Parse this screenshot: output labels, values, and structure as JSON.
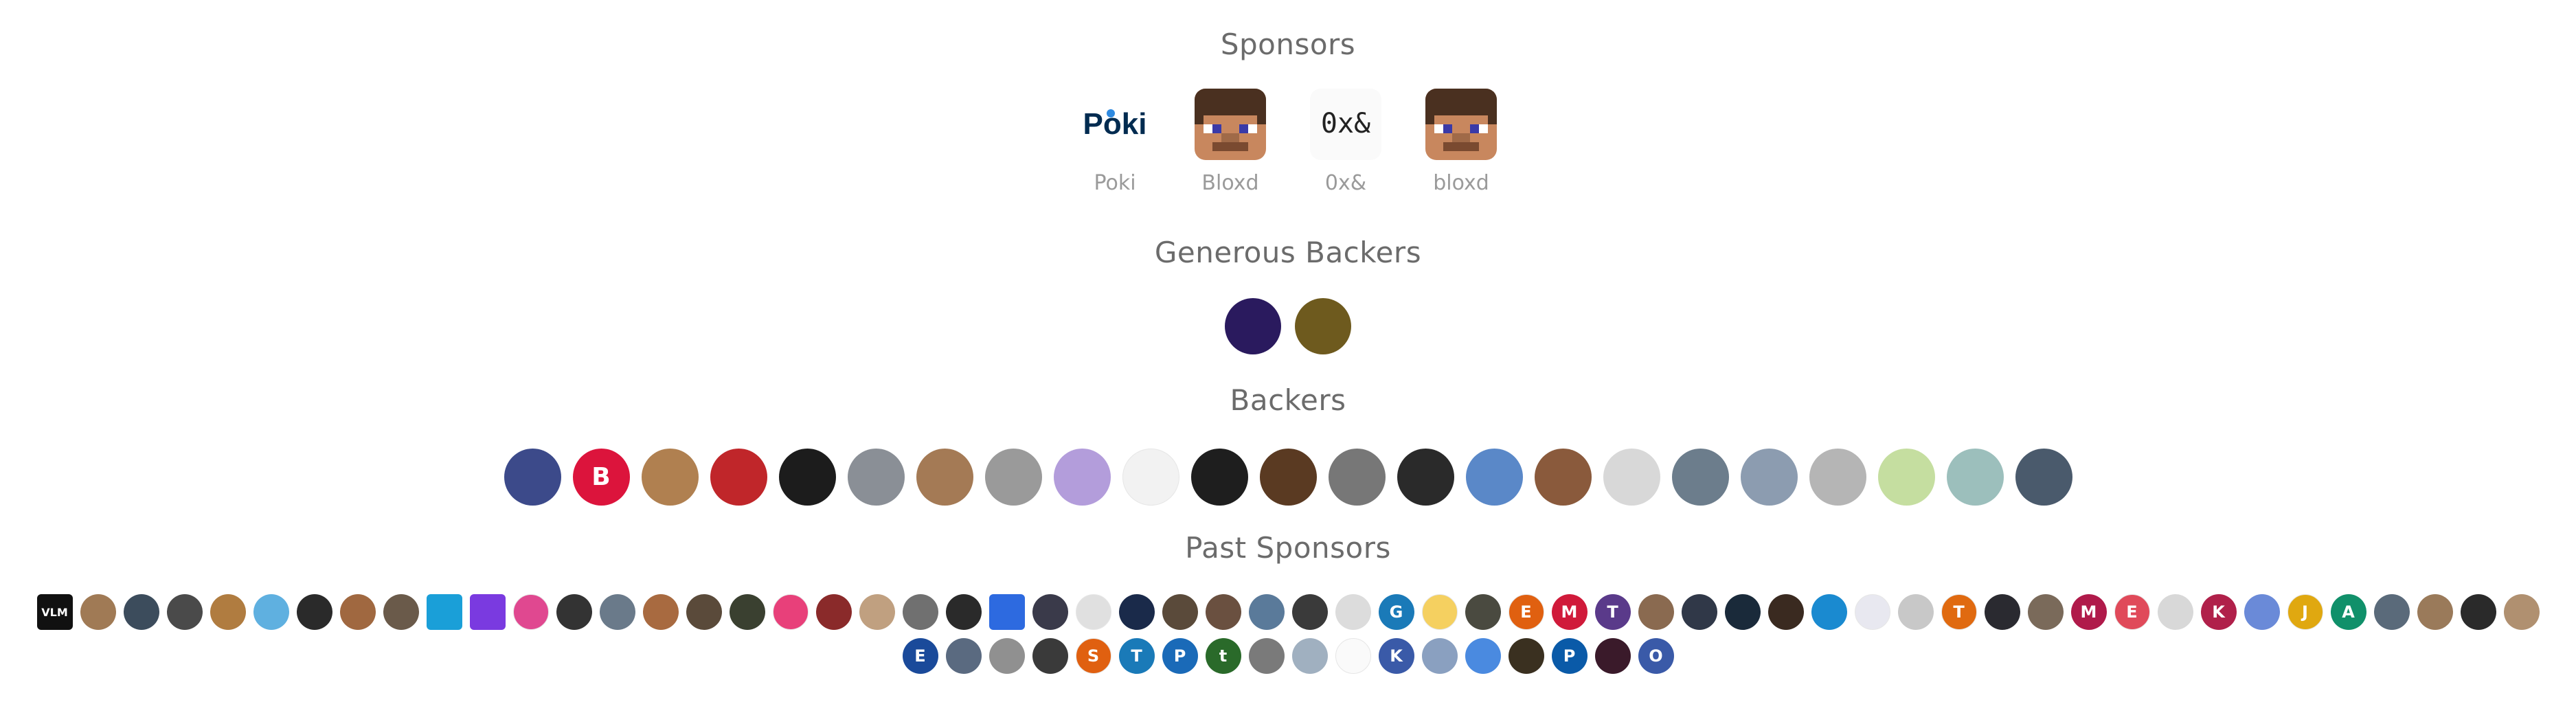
{
  "sponsors": {
    "title": "Sponsors",
    "items": [
      {
        "name": "Poki",
        "logo_text": "Poki",
        "icon": "poki-logo",
        "color": "#002b50",
        "accent": "#2f8ae0"
      },
      {
        "name": "Bloxd",
        "icon": "bloxd-block-face-icon",
        "color": "#c8875e"
      },
      {
        "name": "0x&",
        "logo_text": "0x&",
        "icon": "0x-logo",
        "color": "#222222"
      },
      {
        "name": "bloxd",
        "icon": "bloxd-block-face-icon",
        "color": "#c8875e"
      }
    ]
  },
  "generous_backers": {
    "title": "Generous Backers",
    "items": [
      {
        "icon": "code-avatar-icon",
        "color": "#2a1a5e"
      },
      {
        "icon": "golden-figure-avatar-icon",
        "color": "#6e5a1e"
      }
    ]
  },
  "backers": {
    "title": "Backers",
    "items": [
      {
        "label": "",
        "color": "#3c4a8a"
      },
      {
        "label": "B",
        "color": "#dc143c"
      },
      {
        "label": "",
        "color": "#b08050"
      },
      {
        "label": "",
        "color": "#c0262a"
      },
      {
        "label": "",
        "color": "#1c1c1c"
      },
      {
        "label": "",
        "color": "#8a8f96"
      },
      {
        "label": "",
        "color": "#a47a55"
      },
      {
        "label": "",
        "color": "#9a9a9a"
      },
      {
        "label": "",
        "color": "#b39ddb"
      },
      {
        "label": "",
        "color": "#f2f2f2"
      },
      {
        "label": "",
        "color": "#1e1e1e"
      },
      {
        "label": "",
        "color": "#5a3a22"
      },
      {
        "label": "",
        "color": "#777777"
      },
      {
        "label": "",
        "color": "#2a2a2a"
      },
      {
        "label": "",
        "color": "#5a88c8"
      },
      {
        "label": "",
        "color": "#8a5a3c"
      },
      {
        "label": "",
        "color": "#d8d8d8"
      },
      {
        "label": "",
        "color": "#6c7d8c"
      },
      {
        "label": "",
        "color": "#8c9cb0"
      },
      {
        "label": "",
        "color": "#b5b5b5"
      },
      {
        "label": "",
        "color": "#c5dea0"
      },
      {
        "label": "",
        "color": "#9cbfbc"
      },
      {
        "label": "",
        "color": "#4a5a6c"
      }
    ]
  },
  "past_sponsors": {
    "title": "Past Sponsors",
    "items": [
      {
        "label": "VLM",
        "color": "#111111",
        "square": true
      },
      {
        "label": "",
        "color": "#a07a55"
      },
      {
        "label": "",
        "color": "#3c4c5c"
      },
      {
        "label": "",
        "color": "#4a4a4a"
      },
      {
        "label": "",
        "color": "#b07c40"
      },
      {
        "label": "",
        "color": "#5fb0e0"
      },
      {
        "label": "",
        "color": "#2a2a2a"
      },
      {
        "label": "",
        "color": "#a06840"
      },
      {
        "label": "",
        "color": "#6a5a4a"
      },
      {
        "label": "",
        "color": "#1a9fd8",
        "square": true
      },
      {
        "label": "",
        "color": "#7a3ae0",
        "square": true
      },
      {
        "label": "",
        "color": "#e04890"
      },
      {
        "label": "",
        "color": "#333333"
      },
      {
        "label": "",
        "color": "#6a7a8a"
      },
      {
        "label": "",
        "color": "#a86a40"
      },
      {
        "label": "",
        "color": "#5a4a3a"
      },
      {
        "label": "",
        "color": "#3a4030"
      },
      {
        "label": "",
        "color": "#e8407a"
      },
      {
        "label": "",
        "color": "#8a2a2a"
      },
      {
        "label": "",
        "color": "#c0a080"
      },
      {
        "label": "",
        "color": "#707070"
      },
      {
        "label": "",
        "color": "#2a2a2a"
      },
      {
        "label": "",
        "color": "#2d6ae0",
        "square": true
      },
      {
        "label": "",
        "color": "#3a3a4a"
      },
      {
        "label": "",
        "color": "#e0e0e0"
      },
      {
        "label": "",
        "color": "#1a2a4a"
      },
      {
        "label": "",
        "color": "#5a4a3a"
      },
      {
        "label": "",
        "color": "#6a5040"
      },
      {
        "label": "",
        "color": "#5a7a9a"
      },
      {
        "label": "",
        "color": "#3a3a3a"
      },
      {
        "label": "",
        "color": "#dcdcdc"
      },
      {
        "label": "G",
        "color": "#1a7ab8"
      },
      {
        "label": "",
        "color": "#f5d060"
      },
      {
        "label": "",
        "color": "#4a4a40"
      },
      {
        "label": "E",
        "color": "#e06010"
      },
      {
        "label": "M",
        "color": "#d01a3a"
      },
      {
        "label": "T",
        "color": "#5a3a8a"
      },
      {
        "label": "",
        "color": "#8a6a50"
      },
      {
        "label": "",
        "color": "#303848"
      },
      {
        "label": "",
        "color": "#1a2a3a"
      },
      {
        "label": "",
        "color": "#3a2a20"
      },
      {
        "label": "",
        "color": "#1a8ad0"
      },
      {
        "label": "",
        "color": "#e8e8f0"
      },
      {
        "label": "",
        "color": "#c8c8c8"
      },
      {
        "label": "T",
        "color": "#e06a10"
      },
      {
        "label": "",
        "color": "#2a2a30"
      },
      {
        "label": "",
        "color": "#7a6a5a"
      },
      {
        "label": "M",
        "color": "#b01a4a"
      },
      {
        "label": "E",
        "color": "#e04a5a"
      },
      {
        "label": "",
        "color": "#d8d8d8"
      },
      {
        "label": "K",
        "color": "#b0204a"
      },
      {
        "label": "",
        "color": "#6a8ad8"
      },
      {
        "label": "J",
        "color": "#e0a810"
      },
      {
        "label": "A",
        "color": "#10906a"
      },
      {
        "label": "",
        "color": "#5a6a7a"
      },
      {
        "label": "",
        "color": "#9a7a5a"
      },
      {
        "label": "",
        "color": "#2a2a2a"
      },
      {
        "label": "",
        "color": "#b09070"
      },
      {
        "label": "E",
        "color": "#1a4a9a"
      },
      {
        "label": "",
        "color": "#5a6a80"
      },
      {
        "label": "",
        "color": "#909090"
      },
      {
        "label": "",
        "color": "#3a3a3a"
      },
      {
        "label": "S",
        "color": "#e06010"
      },
      {
        "label": "T",
        "color": "#1a7ab8"
      },
      {
        "label": "P",
        "color": "#1a6ab8"
      },
      {
        "label": "t",
        "color": "#2a6a2a"
      },
      {
        "label": "",
        "color": "#7a7a7a"
      },
      {
        "label": "",
        "color": "#a0b0c0"
      },
      {
        "label": "",
        "color": "#fafafa"
      },
      {
        "label": "K",
        "color": "#3a5aa8"
      },
      {
        "label": "",
        "color": "#8aa0c0"
      },
      {
        "label": "",
        "color": "#4a8ae0"
      },
      {
        "label": "",
        "color": "#3a3020"
      },
      {
        "label": "P",
        "color": "#0a5aa8"
      },
      {
        "label": "",
        "color": "#3a1a2a"
      },
      {
        "label": "O",
        "color": "#3a5aa8"
      }
    ]
  }
}
